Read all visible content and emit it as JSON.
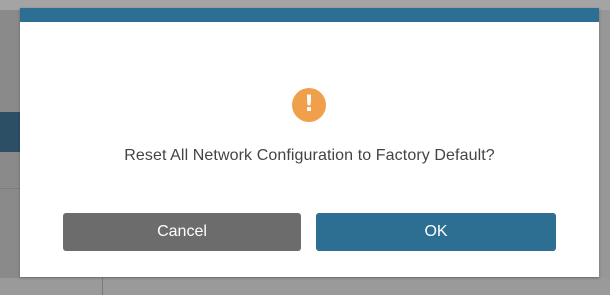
{
  "dialog": {
    "icon": "exclamation-icon",
    "message": "Reset All Network Configuration to Factory Default?",
    "cancel_label": "Cancel",
    "ok_label": "OK"
  },
  "colors": {
    "accent": "#2d6e93",
    "warning": "#f0a04b",
    "cancel_button": "#6c6c6c",
    "overlay": "#8a8a8a"
  }
}
